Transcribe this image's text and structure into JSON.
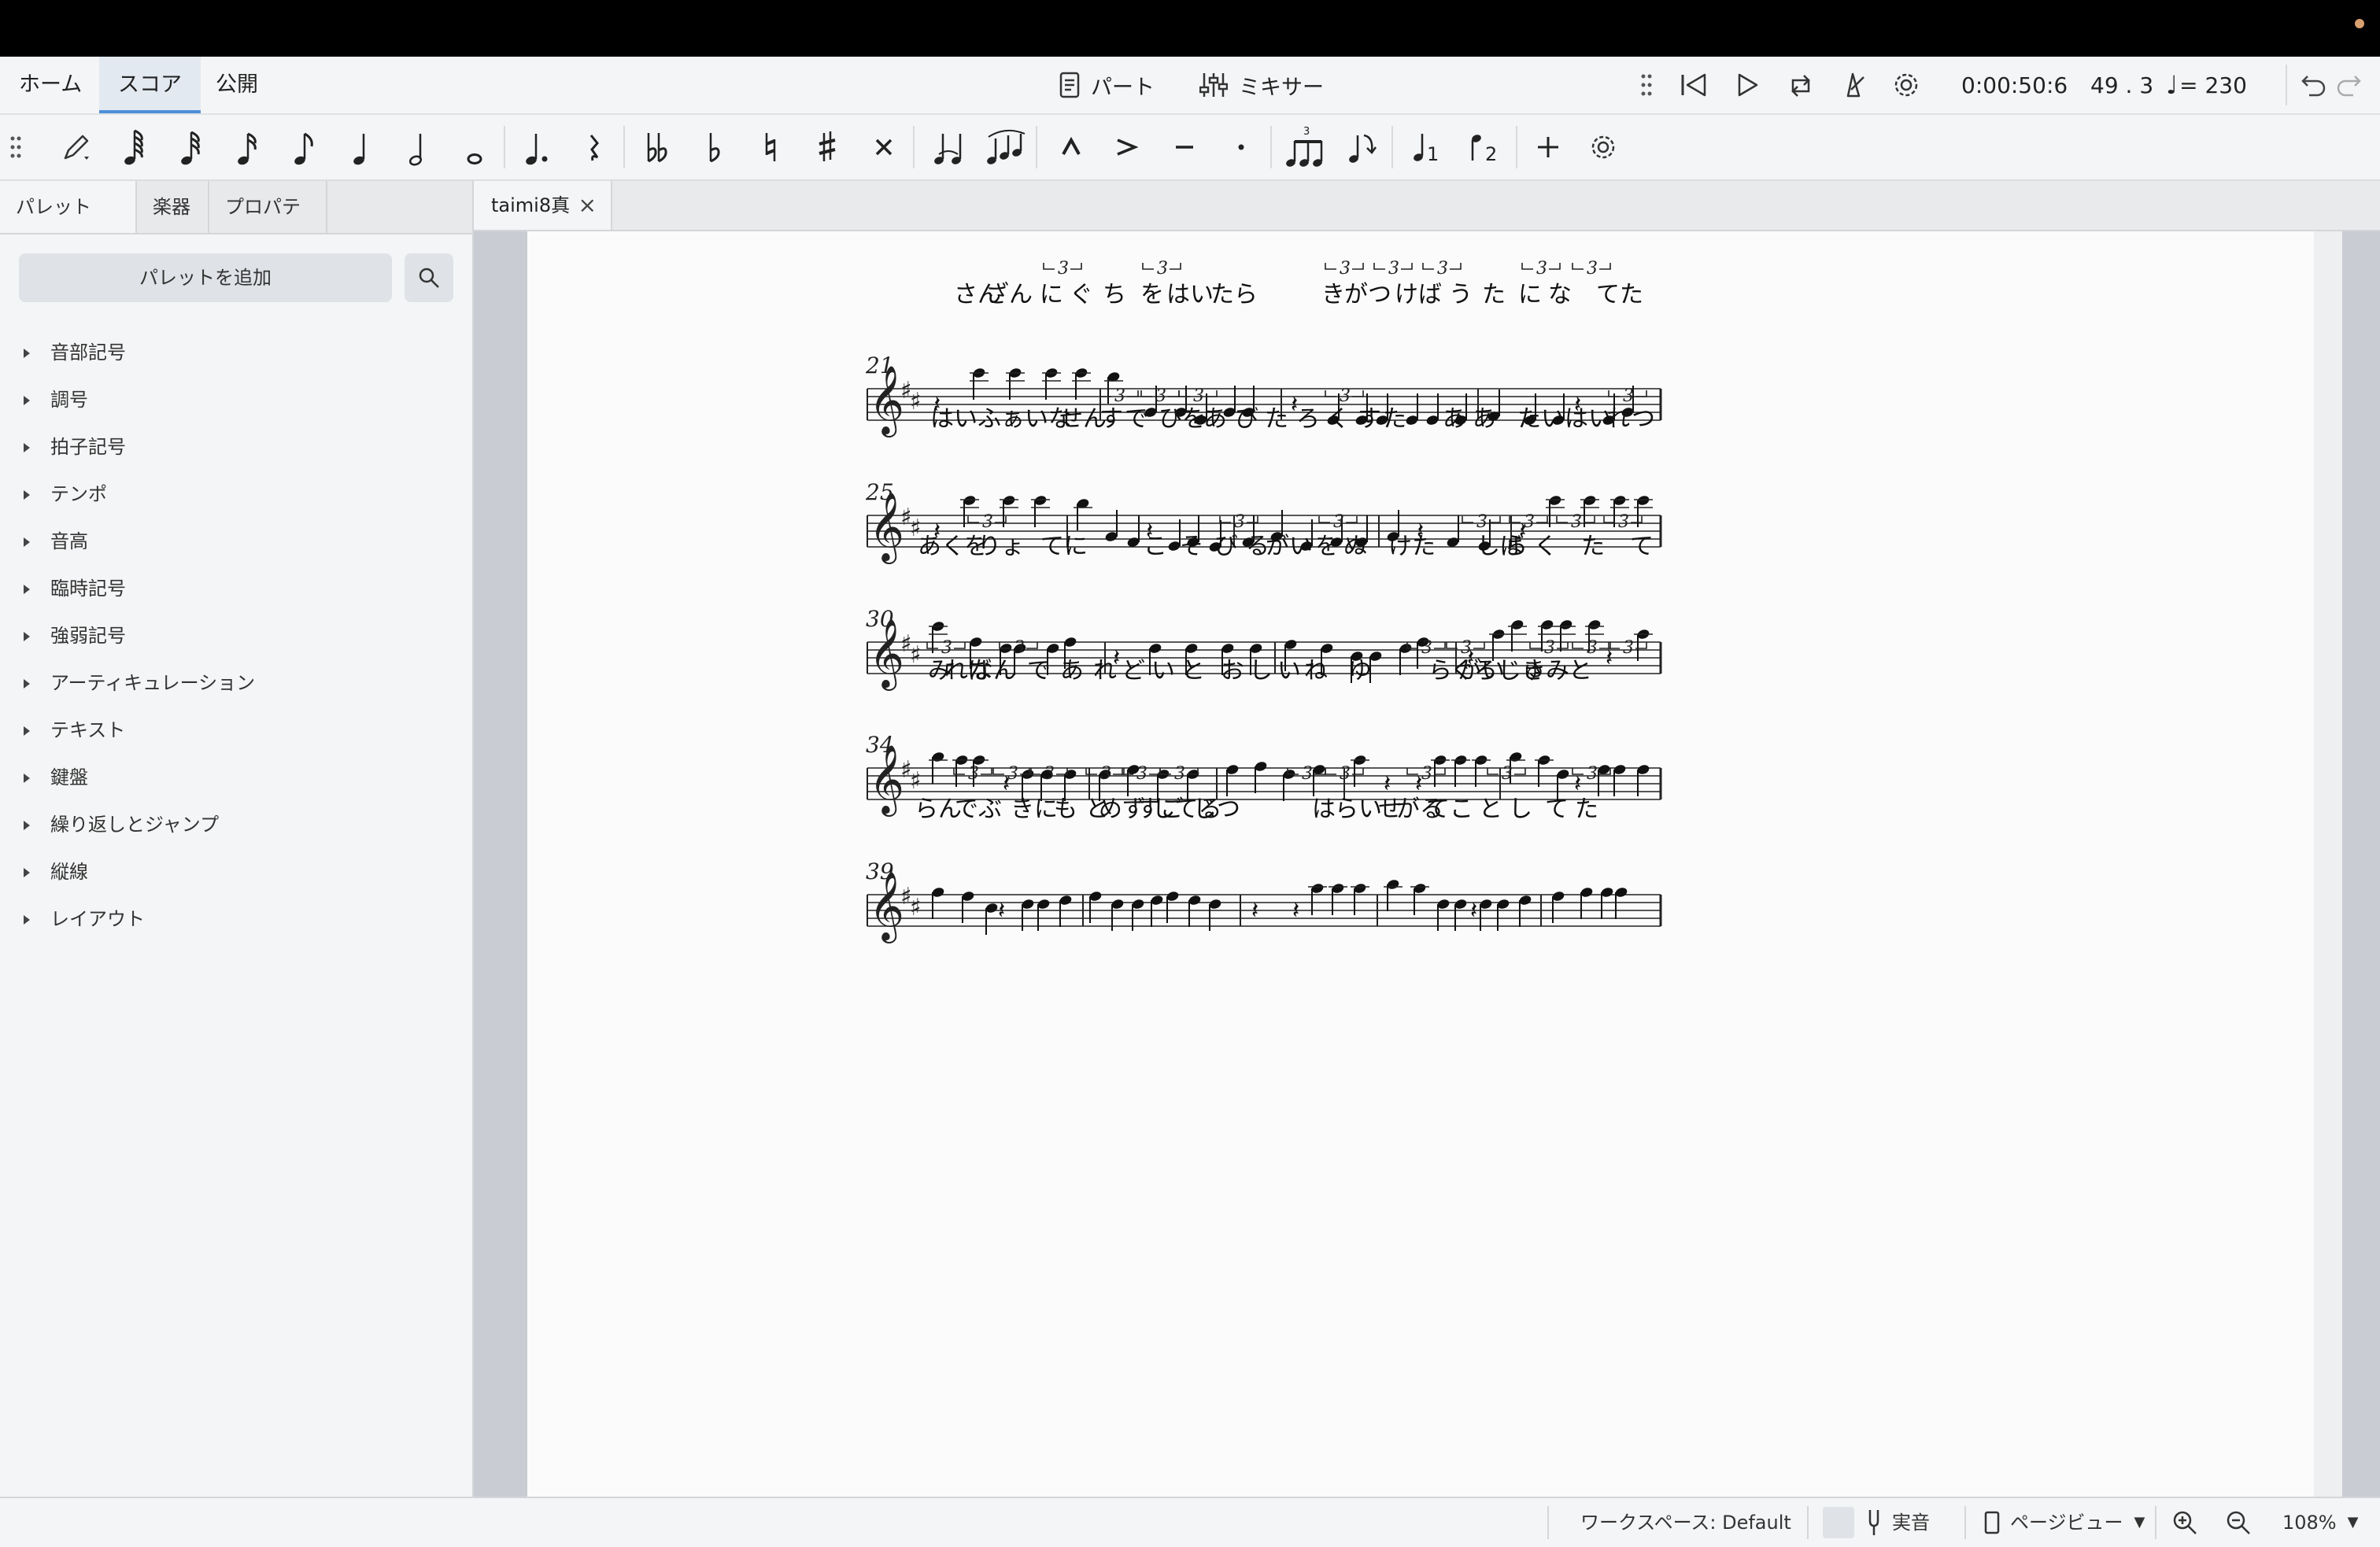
{
  "header": {
    "tabs": [
      {
        "label": "ホーム"
      },
      {
        "label": "スコア",
        "active": true
      },
      {
        "label": "公開"
      }
    ],
    "parts_label": "パート",
    "mixer_label": "ミキサー",
    "playback": {
      "time": "0:00:50:6",
      "position": "49 . 3",
      "tempo": "= 230"
    }
  },
  "left_panel": {
    "tabs": [
      "パレット",
      "楽器",
      "プロパティ"
    ],
    "palette_more": "···",
    "add_palette": "パレットを追加",
    "items": [
      "音部記号",
      "調号",
      "拍子記号",
      "テンポ",
      "音高",
      "臨時記号",
      "強弱記号",
      "アーティキュレーション",
      "テキスト",
      "鍵盤",
      "繰り返しとジャンプ",
      "縦線",
      "レイアウト"
    ]
  },
  "score_tab": {
    "title": "taimi8真"
  },
  "score": {
    "systems": [
      {
        "measure": "21",
        "lyrics": [
          "さん",
          "ざん",
          "に",
          "ぐ",
          "ち",
          "を",
          "はい",
          "たら",
          "き",
          "がつ",
          "けば",
          "う",
          "た",
          "に",
          "な",
          "てた"
        ]
      },
      {
        "measure": "25",
        "lyrics": [
          "はいふぁいな",
          "せん",
          "す",
          "で",
          "ひを",
          "あ",
          "び",
          "た",
          "ろ",
          "く",
          "す",
          "た",
          "あ",
          "あ",
          "たいはい",
          "れ",
          "つ"
        ]
      },
      {
        "measure": "30",
        "lyrics": [
          "あく",
          "を",
          "りょ",
          "てに",
          "こ",
          "そ",
          "び",
          "る",
          "がい",
          "を",
          "ぬ",
          "けた",
          "しば",
          "ら",
          "く",
          "た",
          "て"
        ]
      },
      {
        "measure": "34",
        "lyrics": [
          "み",
          "れば",
          "なん",
          "で",
          "あ",
          "れ",
          "ど",
          "い",
          "と",
          "お",
          "し",
          "い",
          "ね",
          "ゆ",
          "ら",
          "ぐ",
          "がい",
          "ろじゅ",
          "きみ",
          "と"
        ]
      },
      {
        "measure": "39",
        "lyrics": [
          "らん",
          "で",
          "ぶ",
          "きに",
          "も",
          "と",
          "めず",
          "すご",
          "してる",
          "じつ",
          "は",
          "らい",
          "せ",
          "がる",
          "てこ",
          "と",
          "し",
          "て",
          "た"
        ]
      }
    ],
    "tuplet_label": "3"
  },
  "status_bar": {
    "workspace": "ワークスペース: Default",
    "concert_pitch": "実音",
    "view_mode": "ページビュー",
    "zoom": "108%"
  }
}
